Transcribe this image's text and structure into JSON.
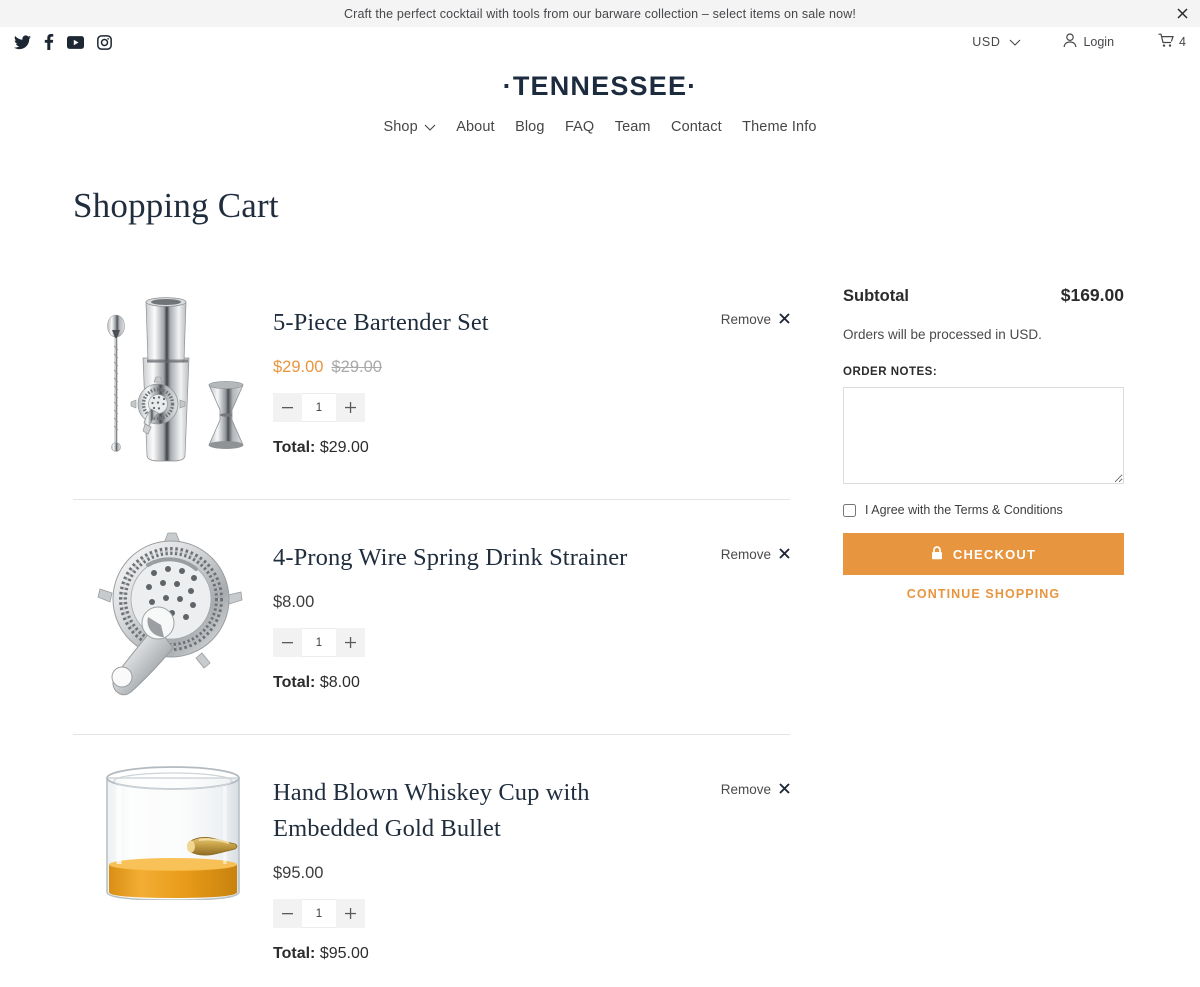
{
  "announcement": {
    "text": "Craft the perfect cocktail with tools from our barware collection – select items on sale now!",
    "close_icon": "close-icon"
  },
  "utility": {
    "social": [
      {
        "name": "twitter-icon",
        "label": "Twitter"
      },
      {
        "name": "facebook-icon",
        "label": "Facebook"
      },
      {
        "name": "youtube-icon",
        "label": "YouTube"
      },
      {
        "name": "instagram-icon",
        "label": "Instagram"
      }
    ],
    "currency": "USD",
    "login": "Login",
    "cart_count": "4"
  },
  "header": {
    "logo": "·TENNESSEE·",
    "nav": [
      {
        "label": "Shop",
        "has_chevron": true
      },
      {
        "label": "About",
        "has_chevron": false
      },
      {
        "label": "Blog",
        "has_chevron": false
      },
      {
        "label": "FAQ",
        "has_chevron": false
      },
      {
        "label": "Team",
        "has_chevron": false
      },
      {
        "label": "Contact",
        "has_chevron": false
      },
      {
        "label": "Theme Info",
        "has_chevron": false
      }
    ]
  },
  "page": {
    "title": "Shopping Cart"
  },
  "cart": {
    "remove_label": "Remove",
    "total_prefix": "Total:",
    "items": [
      {
        "title": "5-Piece Bartender Set",
        "price": "$29.00",
        "compare_at_price": "$29.00",
        "on_sale": true,
        "quantity": "1",
        "line_total": "$29.00",
        "image": "bartender-set"
      },
      {
        "title": "4-Prong Wire Spring Drink Strainer",
        "price": "$8.00",
        "compare_at_price": "",
        "on_sale": false,
        "quantity": "1",
        "line_total": "$8.00",
        "image": "wire-strainer"
      },
      {
        "title": "Hand Blown Whiskey Cup with Embedded Gold Bullet",
        "price": "$95.00",
        "compare_at_price": "",
        "on_sale": false,
        "quantity": "1",
        "line_total": "$95.00",
        "image": "whiskey-cup"
      }
    ]
  },
  "summary": {
    "subtotal_label": "Subtotal",
    "subtotal_value": "$169.00",
    "currency_note": "Orders will be processed in USD.",
    "notes_label": "ORDER NOTES:",
    "notes_value": "",
    "terms_label": "I Agree with the Terms & Conditions",
    "terms_checked": false,
    "checkout_label": "CHECKOUT",
    "checkout_icon": "lock-icon",
    "continue_label": "CONTINUE SHOPPING"
  },
  "colors": {
    "accent_orange": "#e8953f",
    "navy": "#1f2d3d",
    "announce_bg": "#f4f4f4"
  }
}
